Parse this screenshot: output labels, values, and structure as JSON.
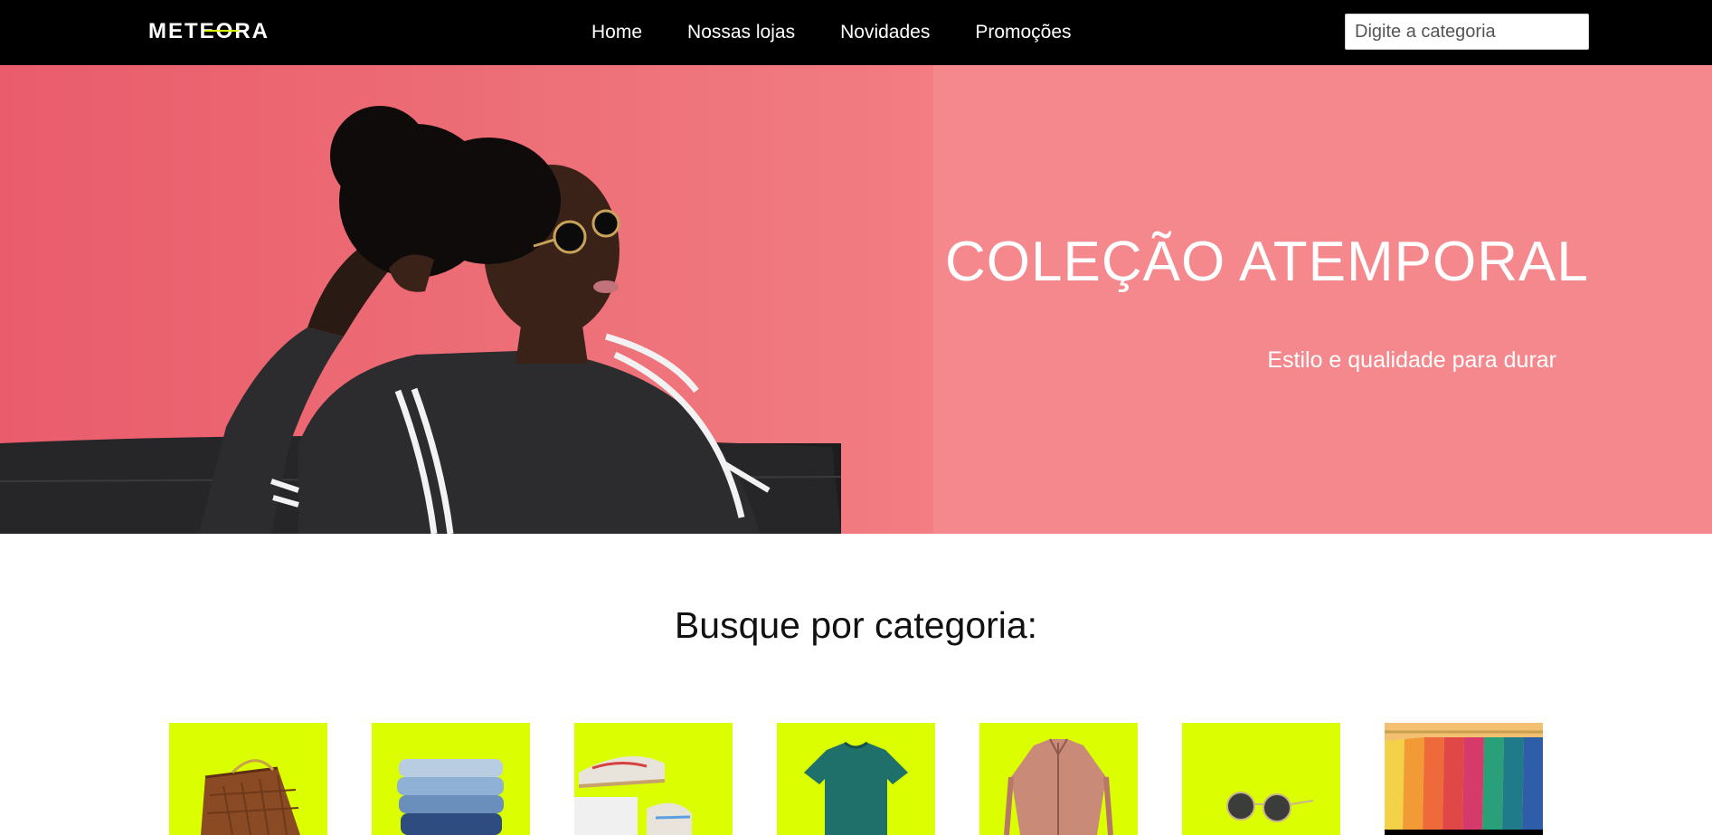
{
  "brand": {
    "logo_text": "METEORA"
  },
  "nav": {
    "items": [
      {
        "label": "Home"
      },
      {
        "label": "Nossas lojas"
      },
      {
        "label": "Novidades"
      },
      {
        "label": "Promoções"
      }
    ]
  },
  "search": {
    "placeholder": "Digite a categoria",
    "value": ""
  },
  "hero": {
    "title": "COLEÇÃO ATEMPORAL",
    "subtitle": "Estilo e qualidade para durar",
    "background_color": "#f4888c"
  },
  "categories": {
    "heading": "Busque por categoria:",
    "accent_color": "#dbff00",
    "items": [
      {
        "icon": "bag-icon"
      },
      {
        "icon": "jeans-icon"
      },
      {
        "icon": "sneakers-icon"
      },
      {
        "icon": "tshirt-icon"
      },
      {
        "icon": "jacket-icon"
      },
      {
        "icon": "sunglasses-icon"
      },
      {
        "icon": "clothes-rack-icon"
      }
    ]
  }
}
